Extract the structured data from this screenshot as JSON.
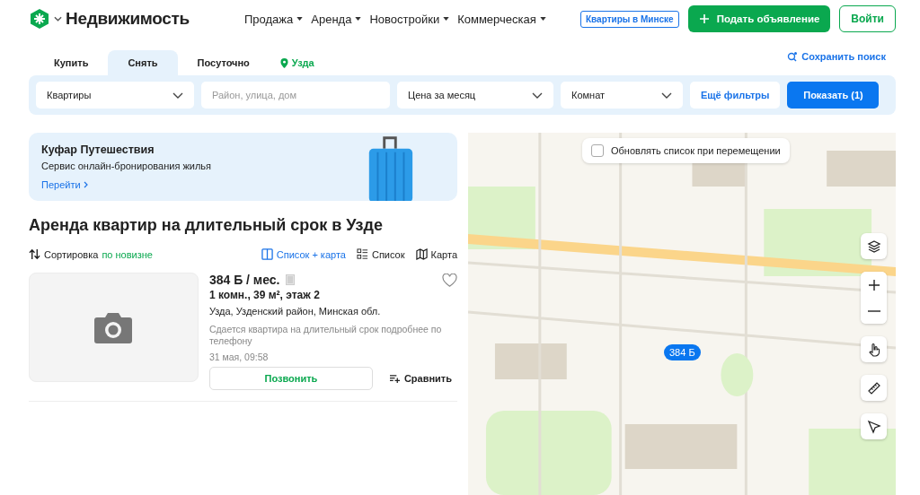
{
  "header": {
    "logo": "Недвижимость",
    "nav": [
      {
        "label": "Продажа"
      },
      {
        "label": "Аренда"
      },
      {
        "label": "Новостройки"
      },
      {
        "label": "Коммерческая"
      }
    ],
    "minsk_badge": "Квартиры в Минске",
    "post_button": "Подать объявление",
    "login_button": "Войти"
  },
  "tabs": [
    {
      "label": "Купить",
      "selected": false
    },
    {
      "label": "Снять",
      "selected": true
    },
    {
      "label": "Посуточно",
      "selected": false
    }
  ],
  "location": "Узда",
  "save_search": "Сохранить поиск",
  "filters": {
    "type": "Квартиры",
    "address_placeholder": "Район, улица, дом",
    "price": "Цена за месяц",
    "rooms": "Комнат",
    "more": "Ещё фильтры",
    "show": "Показать (1)"
  },
  "promo": {
    "title": "Куфар Путешествия",
    "subtitle": "Сервис онлайн-бронирования жилья",
    "link": "Перейти"
  },
  "heading": "Аренда квартир на длительный срок в Узде",
  "sort": {
    "label": "Сортировка",
    "value": "по новизне"
  },
  "views": [
    {
      "label": "Список + карта",
      "selected": true
    },
    {
      "label": "Список",
      "selected": false
    },
    {
      "label": "Карта",
      "selected": false
    }
  ],
  "listing": {
    "price": "384 Б / мес.",
    "details": "1 комн., 39 м², этаж 2",
    "address": "Узда, Узденский район, Минская обл.",
    "description": "Сдается квартира на длительный срок подробнее по телефону",
    "date": "31 мая, 09:58",
    "call_button": "Позвонить",
    "compare": "Сравнить",
    "favorite": false
  },
  "map": {
    "update_on_move": {
      "label": "Обновлять список при перемещении",
      "checked": false
    },
    "pin": "384 Б"
  }
}
